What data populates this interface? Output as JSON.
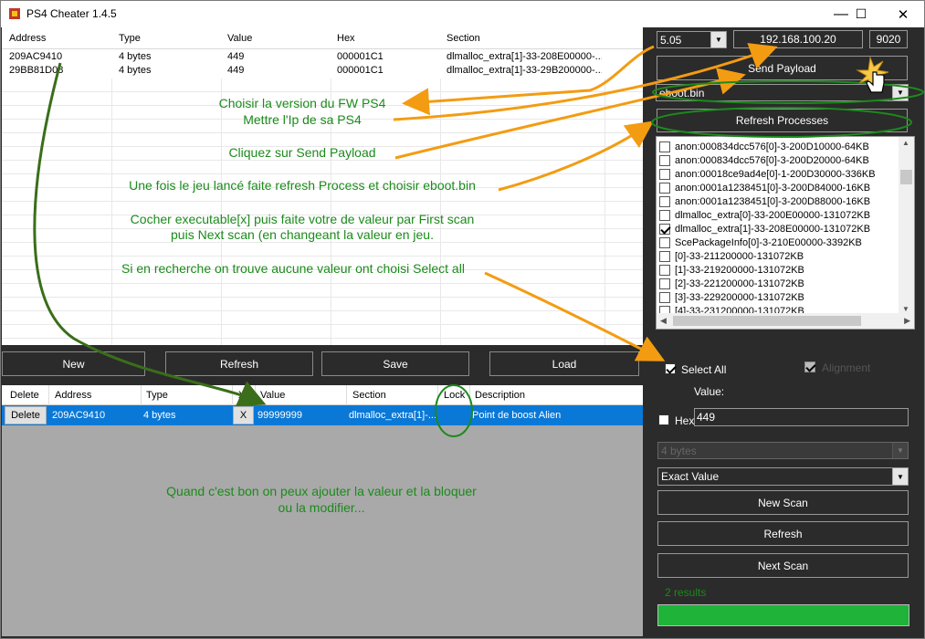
{
  "window": {
    "title": "PS4 Cheater 1.4.5",
    "controls": {
      "minimize": "—",
      "maximize": "☐",
      "close": "✕"
    }
  },
  "scan_results": {
    "columns": [
      "Address",
      "Type",
      "Value",
      "Hex",
      "Section"
    ],
    "rows": [
      {
        "address": "209AC9410",
        "type": "4 bytes",
        "value": "449",
        "hex": "000001C1",
        "section": "dlmalloc_extra[1]-33-208E00000-..."
      },
      {
        "address": "29BB81D08",
        "type": "4 bytes",
        "value": "449",
        "hex": "000001C1",
        "section": "dlmalloc_extra[1]-33-29B200000-..."
      }
    ]
  },
  "toolbar": {
    "new": "New",
    "refresh": "Refresh",
    "save": "Save",
    "load": "Load"
  },
  "saved_list": {
    "columns": [
      "Delete",
      "Address",
      "Type",
      "X",
      "Value",
      "Section",
      "Lock",
      "Description"
    ],
    "row": {
      "delete": "Delete",
      "address": "209AC9410",
      "type": "4 bytes",
      "x": "X",
      "value": "99999999",
      "section": "dlmalloc_extra[1]-...",
      "locked": true,
      "description": "Point de boost Alien"
    }
  },
  "connection": {
    "fw_version": "5.05",
    "ip": "192.168.100.20",
    "port": "9020",
    "send_payload": "Send Payload",
    "process": "eboot.bin",
    "refresh_processes": "Refresh Processes"
  },
  "sections": [
    {
      "label": "anon:000834dcc576[0]-3-200D10000-64KB",
      "checked": false
    },
    {
      "label": "anon:000834dcc576[0]-3-200D20000-64KB",
      "checked": false
    },
    {
      "label": "anon:00018ce9ad4e[0]-1-200D30000-336KB",
      "checked": false
    },
    {
      "label": "anon:0001a1238451[0]-3-200D84000-16KB",
      "checked": false
    },
    {
      "label": "anon:0001a1238451[0]-3-200D88000-16KB",
      "checked": false
    },
    {
      "label": "dlmalloc_extra[0]-33-200E00000-131072KB",
      "checked": false
    },
    {
      "label": "dlmalloc_extra[1]-33-208E00000-131072KB",
      "checked": true
    },
    {
      "label": "ScePackageInfo[0]-3-210E00000-3392KB",
      "checked": false
    },
    {
      "label": "[0]-33-211200000-131072KB",
      "checked": false
    },
    {
      "label": "[1]-33-219200000-131072KB",
      "checked": false
    },
    {
      "label": "[2]-33-221200000-131072KB",
      "checked": false
    },
    {
      "label": "[3]-33-229200000-131072KB",
      "checked": false
    },
    {
      "label": "[4]-33-231200000-131072KB",
      "checked": false
    }
  ],
  "scan_options": {
    "select_all": "Select All",
    "select_all_checked": true,
    "alignment": "Alignment",
    "alignment_checked": true,
    "value_label": "Value:",
    "hex_label": "Hex",
    "value": "449",
    "value_type": "4 bytes",
    "compare_type": "Exact Value",
    "new_scan": "New Scan",
    "refresh": "Refresh",
    "next_scan": "Next Scan",
    "results": "2 results",
    "progress": 1.0
  },
  "annotations": {
    "fw": "Choisir la version du FW PS4",
    "ip": "Mettre l'Ip de sa PS4",
    "payload": "Cliquez sur Send Payload",
    "refresh": "Une fois le jeu lancé faite refresh Process et choisir eboot.bin",
    "scan1": "Cocher executable[x] puis faite votre de valeur par First scan",
    "scan2": "puis Next scan (en changeant la valeur en jeu.",
    "selectall": "Si en recherche on trouve aucune valeur ont choisi Select all",
    "final1": "Quand c'est bon on peux ajouter la valeur et la bloquer",
    "final2": "ou la modifier..."
  },
  "colors": {
    "accent": "#0a78d7",
    "annotation_text": "#1c8a1c",
    "arrow_orange": "#f39c12",
    "arrow_green": "#3a6e1a",
    "progress": "#1fb33a"
  }
}
